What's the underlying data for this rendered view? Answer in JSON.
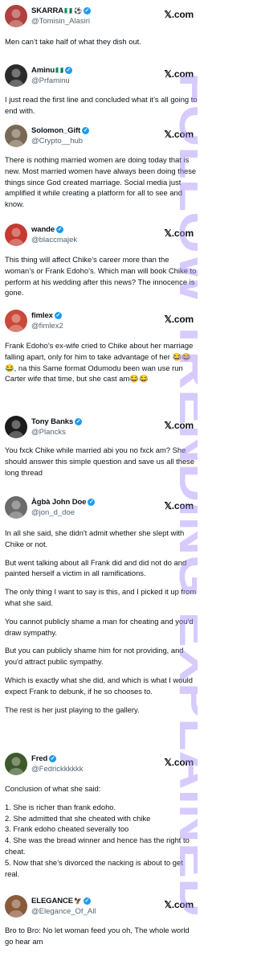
{
  "brand": {
    "logo_text": "𝕏.com"
  },
  "watermark": {
    "text": "FOLLOW TRENDING EXPLAINED",
    "color": "#a78bfa"
  },
  "tweets": [
    {
      "name": "SKARRA",
      "name_emoji": "🇳🇬 ⚽",
      "verified": true,
      "handle": "@Tomisin_Alasiri",
      "avatar_color": "#b0413e",
      "paragraphs": [
        "Men can’t take half of what they dish out."
      ]
    },
    {
      "name": "Aminu",
      "name_emoji": "🇳🇬",
      "verified": true,
      "handle": "@Prfaminu",
      "avatar_color": "#2b2b2b",
      "paragraphs": [
        "I just read the first line and concluded what it’s all going to end with."
      ]
    },
    {
      "name": "Solomon_Gift",
      "name_emoji": "",
      "verified": true,
      "handle": "@Crypto__hub",
      "avatar_color": "#7a6a55",
      "paragraphs": [
        "There is nothing married women are doing today that is new. Most married women have always been doing these things since God created marriage. Social media just amplified it while creating a platform for all to see and know."
      ]
    },
    {
      "name": "wande",
      "name_emoji": "",
      "verified": true,
      "handle": "@blaccmajek",
      "avatar_color": "#c53a2f",
      "paragraphs": [
        "This thing will affect Chike’s career more than the woman’s or Frank Edoho’s. Which man will book Chike to perform at his wedding after this news? The innocence is gone."
      ]
    },
    {
      "name": "fimlex",
      "name_emoji": "",
      "verified": true,
      "handle": "@fimlex2",
      "avatar_color": "#c94a3a",
      "paragraphs": [
        "Frank Edoho’s ex-wife cried to Chike about her marriage falling apart, only for him to take advantage of her 😂😂😂, na this Same format Odumodu been wan use run Carter wife that time, but she cast am😂😂"
      ]
    },
    {
      "name": "Tony Banks",
      "name_emoji": "",
      "verified": true,
      "handle": "@Plancks",
      "avatar_color": "#1c1c1c",
      "paragraphs": [
        "You fxck Chike while married abi you no fxck am? She should answer this simple question and save us all these long thread"
      ]
    },
    {
      "name": "Àgbà John Doe",
      "name_emoji": "",
      "verified": true,
      "handle": "@jon_d_doe",
      "avatar_color": "#6b6b6b",
      "paragraphs": [
        "In all she said, she didn't admit whether she slept with Chike or not.",
        "But went talking about all Frank did and did not do and painted herself a victim in all ramifications.",
        "The only thing I want to say is this, and I picked it up from what she said.",
        "You cannot publicly shame a man for cheating and you'd draw sympathy.",
        "But you can publicly shame him for not providing, and you'd attract public sympathy.",
        "Which is exactly what she did, and which is what I would expect Frank to debunk, if he so chooses to.",
        "The rest is her just playing to the gallery."
      ]
    },
    {
      "name": "Fred",
      "name_emoji": "",
      "verified": true,
      "handle": "@Fedrickkkkkk",
      "avatar_color": "#3f5a2a",
      "paragraphs": [
        "Conclusion of what she said:",
        "1. She is richer than frank edoho.\n2. She admitted that she cheated with chike\n3. Frank edoho cheated severally too\n4. She was the bread winner and hence has the right to cheat.\n5. Now that she’s divorced the nacking is about to get real."
      ]
    },
    {
      "name": "ELEGANCE",
      "name_emoji": "🦅",
      "verified": true,
      "handle": "@Elegance_Of_All",
      "avatar_color": "#8a5a3a",
      "paragraphs": [
        "Bro to Bro: No let woman feed you oh, The whole world go hear am"
      ]
    }
  ]
}
